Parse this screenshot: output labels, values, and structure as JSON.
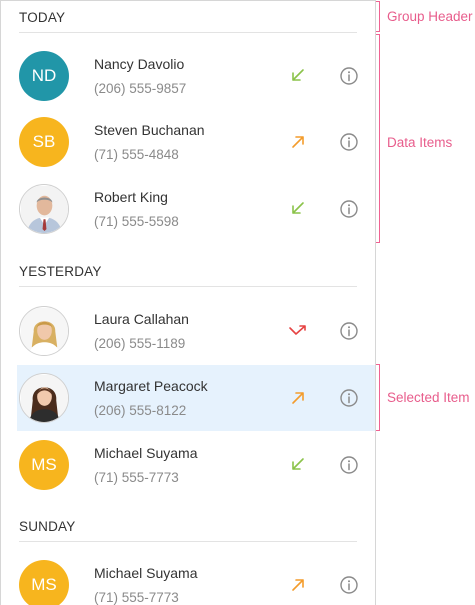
{
  "colors": {
    "accent_teal": "#2196a8",
    "accent_amber": "#f7b51e",
    "incoming_green": "#8bc34a",
    "outgoing_orange": "#f39c2c",
    "missed_red": "#e64343",
    "selected_bg": "#e6f2fd",
    "annotation_pink": "#e85d8c"
  },
  "groups": [
    {
      "header": "TODAY",
      "items": [
        {
          "initials": "ND",
          "name": "Nancy Davolio",
          "phone": "(206) 555-9857",
          "avatar_type": "initials",
          "avatar_color": "#2196a8",
          "call_type": "incoming",
          "call_icon": "incoming-call-icon",
          "selected": false
        },
        {
          "initials": "SB",
          "name": "Steven Buchanan",
          "phone": "(71) 555-4848",
          "avatar_type": "initials",
          "avatar_color": "#f7b51e",
          "call_type": "outgoing",
          "call_icon": "outgoing-call-icon",
          "selected": false
        },
        {
          "initials": "",
          "name": "Robert King",
          "phone": "(71) 555-5598",
          "avatar_type": "photo-man-suit",
          "avatar_color": "#ffffff",
          "call_type": "incoming",
          "call_icon": "incoming-call-icon",
          "selected": false
        }
      ]
    },
    {
      "header": "YESTERDAY",
      "items": [
        {
          "initials": "",
          "name": "Laura Callahan",
          "phone": "(206) 555-1189",
          "avatar_type": "photo-woman-blonde",
          "avatar_color": "#ffffff",
          "call_type": "missed",
          "call_icon": "missed-call-icon",
          "selected": false
        },
        {
          "initials": "",
          "name": "Margaret Peacock",
          "phone": "(206) 555-8122",
          "avatar_type": "photo-woman-brunette",
          "avatar_color": "#ffffff",
          "call_type": "outgoing",
          "call_icon": "outgoing-call-icon",
          "selected": true
        },
        {
          "initials": "MS",
          "name": "Michael Suyama",
          "phone": "(71) 555-7773",
          "avatar_type": "initials",
          "avatar_color": "#f7b51e",
          "call_type": "incoming",
          "call_icon": "incoming-call-icon",
          "selected": false
        }
      ]
    },
    {
      "header": "SUNDAY",
      "items": [
        {
          "initials": "MS",
          "name": "Michael Suyama",
          "phone": "(71) 555-7773",
          "avatar_type": "initials",
          "avatar_color": "#f7b51e",
          "call_type": "outgoing",
          "call_icon": "outgoing-call-icon",
          "selected": false
        }
      ]
    }
  ],
  "annotations": {
    "group_header": "Group Header",
    "data_items": "Data Items",
    "selected_item": "Selected Item"
  }
}
